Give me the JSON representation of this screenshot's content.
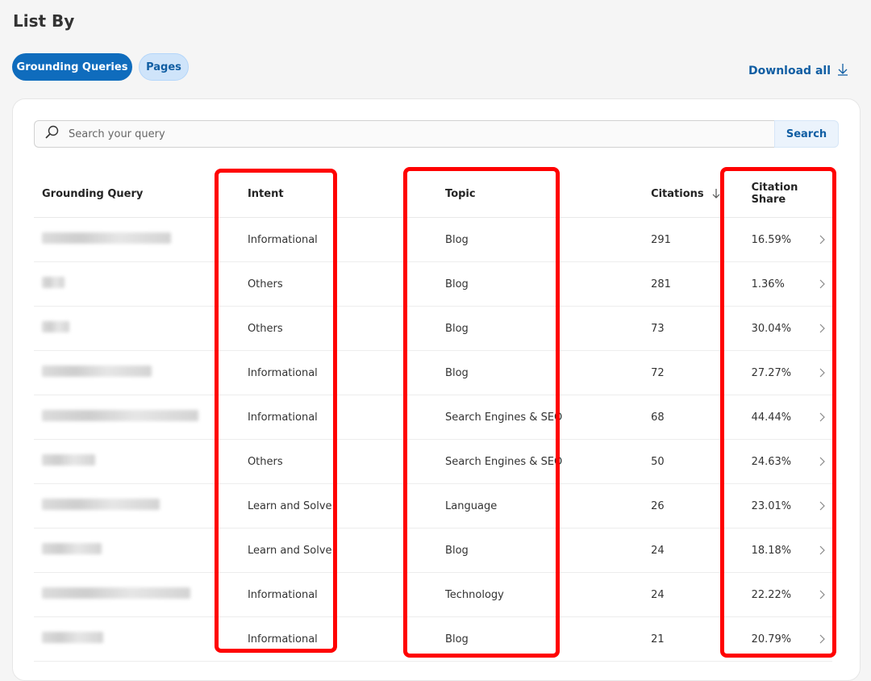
{
  "header": {
    "title": "List By",
    "download_label": "Download all"
  },
  "toggles": {
    "active_label": "Grounding Queries",
    "inactive_label": "Pages"
  },
  "search": {
    "placeholder": "Search your query",
    "button_label": "Search"
  },
  "table": {
    "columns": [
      "Grounding Query",
      "Intent",
      "Topic",
      "Citations",
      "Citation Share"
    ],
    "rows": [
      {
        "intent": "Informational",
        "topic": "Blog",
        "citations": "291",
        "share": "16.59%"
      },
      {
        "intent": "Others",
        "topic": "Blog",
        "citations": "281",
        "share": "1.36%"
      },
      {
        "intent": "Others",
        "topic": "Blog",
        "citations": "73",
        "share": "30.04%"
      },
      {
        "intent": "Informational",
        "topic": "Blog",
        "citations": "72",
        "share": "27.27%"
      },
      {
        "intent": "Informational",
        "topic": "Search Engines & SEO",
        "citations": "68",
        "share": "44.44%"
      },
      {
        "intent": "Others",
        "topic": "Search Engines & SEO",
        "citations": "50",
        "share": "24.63%"
      },
      {
        "intent": "Learn and Solve",
        "topic": "Language",
        "citations": "26",
        "share": "23.01%"
      },
      {
        "intent": "Learn and Solve",
        "topic": "Blog",
        "citations": "24",
        "share": "18.18%"
      },
      {
        "intent": "Informational",
        "topic": "Technology",
        "citations": "24",
        "share": "22.22%"
      },
      {
        "intent": "Informational",
        "topic": "Blog",
        "citations": "21",
        "share": "20.79%"
      }
    ]
  },
  "colors": {
    "accent": "#0f6cbd",
    "highlight": "#ff0000"
  },
  "icons": {
    "download": "download-icon",
    "search": "search-icon",
    "sort": "sort-down-icon",
    "row": "chevron-right-icon"
  }
}
